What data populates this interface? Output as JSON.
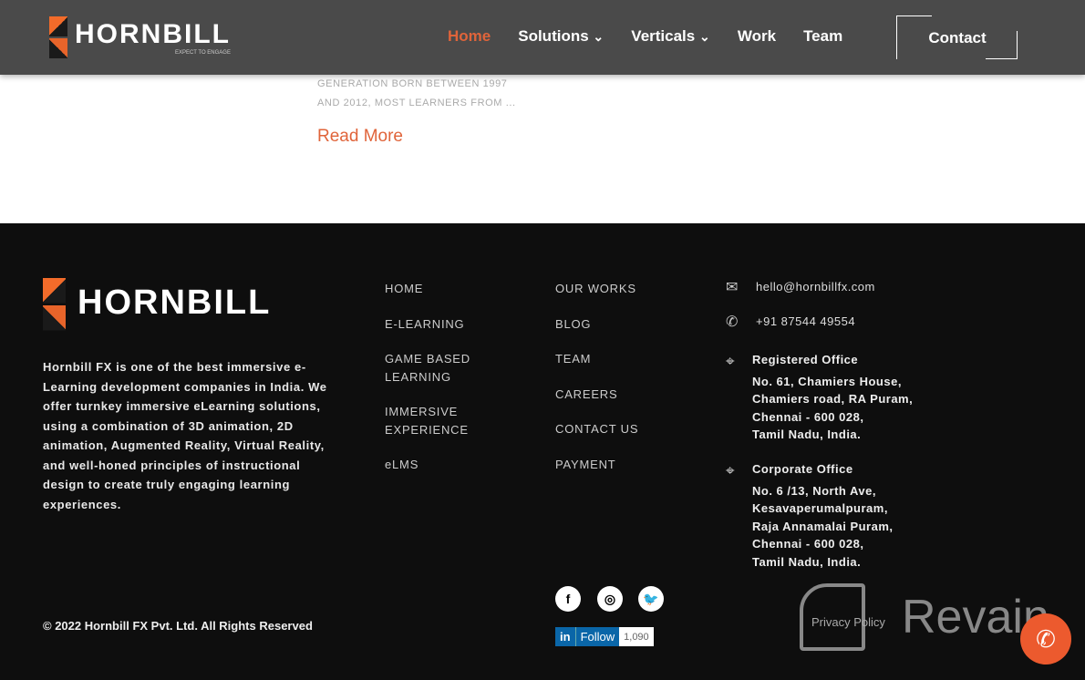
{
  "header": {
    "logo": "HORNBILL",
    "logo_tag": "EXPECT TO ENGAGE",
    "nav": [
      "Home",
      "Solutions",
      "Verticals",
      "Work",
      "Team"
    ],
    "contact": "Contact"
  },
  "blog": {
    "line1": "GENERATION BORN BETWEEN 1997",
    "line2": "AND 2012, MOST LEARNERS FROM ...",
    "read_more": "Read More"
  },
  "footer": {
    "logo": "HORNBILL",
    "about": "Hornbill FX is one of the best immersive e-Learning development companies in India. We offer turnkey immersive eLearning solutions, using a combination of 3D animation, 2D animation, Augmented Reality, Virtual Reality, and well-honed principles of instructional design to create truly engaging learning experiences.",
    "links1": [
      "HOME",
      "E-LEARNING",
      "GAME BASED LEARNING",
      "IMMERSIVE EXPERIENCE",
      "eLMS"
    ],
    "links2": [
      "OUR WORKS",
      "BLOG",
      "TEAM",
      "CAREERS",
      "CONTACT US",
      "PAYMENT"
    ],
    "email": "hello@hornbillfx.com",
    "phone": "+91 87544 49554",
    "reg_title": "Registered Office",
    "reg_lines": [
      "No. 61, Chamiers House,",
      "Chamiers road, RA Puram,",
      "Chennai - 600 028,",
      "Tamil Nadu, India."
    ],
    "corp_title": "Corporate Office",
    "corp_lines": [
      "No. 6 /13, North Ave,",
      "Kesavaperumalpuram,",
      "Raja Annamalai Puram,",
      "Chennai - 600 028,",
      "Tamil Nadu, India."
    ],
    "copyright": "© 2022 Hornbill FX Pvt. Ltd. All Rights Reserved",
    "linkedin": {
      "in": "in",
      "follow": "Follow",
      "count": "1,090"
    },
    "privacy": "Privacy Policy",
    "watermark": "Revain"
  },
  "colors": {
    "accent": "#e0643a",
    "header_bg": "#4a4a4a",
    "footer_bg": "#0e0e0e"
  }
}
